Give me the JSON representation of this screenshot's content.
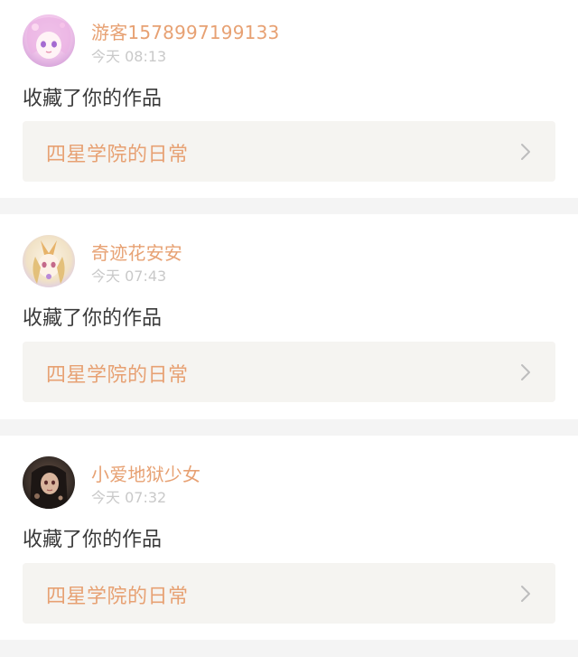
{
  "notifications": [
    {
      "username": "游客1578997199133",
      "time": "今天 08:13",
      "action": "收藏了你的作品",
      "work_title": "四星学院的日常",
      "avatar_colors": [
        "#f6d6ee",
        "#e7b5e6",
        "#fce6f6"
      ]
    },
    {
      "username": "奇迹花安安",
      "time": "今天 07:43",
      "action": "收藏了你的作品",
      "work_title": "四星学院的日常",
      "avatar_colors": [
        "#f2ead8",
        "#e7b36a",
        "#c8a6e0"
      ]
    },
    {
      "username": "小爱地狱少女",
      "time": "今天 07:32",
      "action": "收藏了你的作品",
      "work_title": "四星学院的日常",
      "avatar_colors": [
        "#2f2a28",
        "#7a5d4e",
        "#c9a38a"
      ]
    }
  ],
  "colors": {
    "accent": "#e7a173",
    "time_text": "#c9c9c9",
    "body_text": "#3a3a3a",
    "link_bg": "#f5f4f1",
    "divider_bg": "#f4f4f4"
  },
  "icons": {
    "chevron": "chevron-right-icon"
  }
}
